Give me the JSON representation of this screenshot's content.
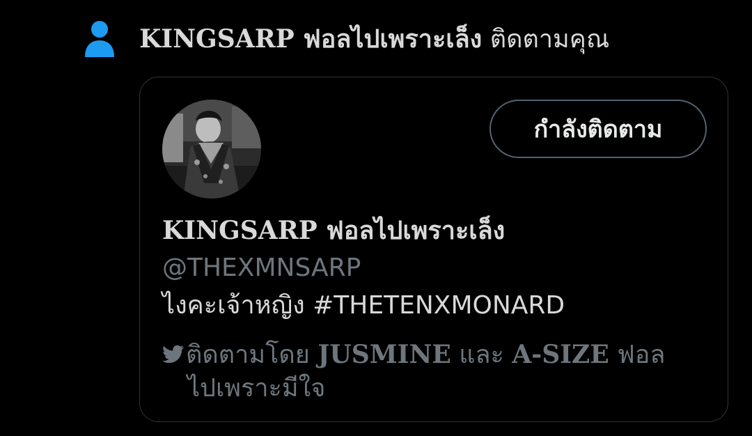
{
  "notification": {
    "icon": "person-icon",
    "icon_color": "#1d9bf0",
    "name": "KINGSARP ฟอลไปเพราะเล็ง",
    "action": "ติดตามคุณ"
  },
  "card": {
    "avatar_alt": "profile photo",
    "follow_button_label": "กำลังติดตาม",
    "display_name": "KINGSARP ฟอลไปเพราะเล็ง",
    "handle": "@THEXMNSARP",
    "bio": "ไงคะเจ้าหญิง #THETENXMONARD",
    "followed_by": {
      "icon": "twitter-bird-icon",
      "prefix": "ติดตามโดย",
      "name1": "JUSMINE",
      "connector": "และ",
      "name2": "A-SIZE",
      "suffix_line1": "ฟอล",
      "suffix_line2": "ไปเพราะมีใจ"
    }
  },
  "colors": {
    "background": "#000000",
    "text_primary": "#d9d9d9",
    "text_secondary": "#6e767d",
    "card_border": "#2f3336",
    "button_border": "#536471"
  }
}
